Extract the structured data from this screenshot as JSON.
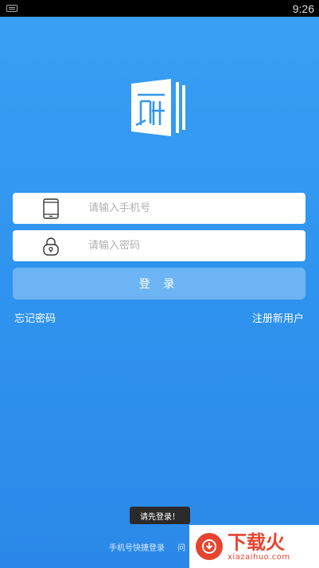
{
  "status_bar": {
    "time": "9:26",
    "keyboard_icon": "keyboard-icon"
  },
  "login": {
    "phone_placeholder": "请输入手机号",
    "password_placeholder": "请输入密码",
    "login_label": "登 录",
    "forgot_password": "忘记密码",
    "register": "注册新用户"
  },
  "toast": {
    "message": "请先登录！"
  },
  "bottom": {
    "quick_login": "手机号快捷登录",
    "help": "问"
  },
  "watermark": {
    "title": "下载火",
    "url": "xiazaihuo.com"
  },
  "colors": {
    "primary": "#3398f0",
    "watermark_red": "#e8432e"
  }
}
